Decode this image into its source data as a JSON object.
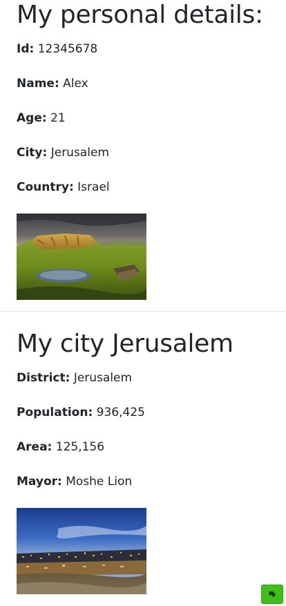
{
  "personal": {
    "heading": "My personal details:",
    "fields": [
      {
        "label": "Id:",
        "value": "12345678"
      },
      {
        "label": "Name:",
        "value": "Alex"
      },
      {
        "label": "Age:",
        "value": "21"
      },
      {
        "label": "City:",
        "value": "Jerusalem"
      },
      {
        "label": "Country:",
        "value": "Israel"
      }
    ]
  },
  "city": {
    "heading": "My city Jerusalem",
    "fields": [
      {
        "label": "District:",
        "value": "Jerusalem"
      },
      {
        "label": "Population:",
        "value": "936,425"
      },
      {
        "label": "Area:",
        "value": "125,156"
      },
      {
        "label": "Mayor:",
        "value": "Moshe Lion"
      }
    ]
  },
  "colors": {
    "text": "#212529",
    "fab": "#3fbf1a"
  },
  "icons": {
    "fab": "feedback-icon"
  }
}
